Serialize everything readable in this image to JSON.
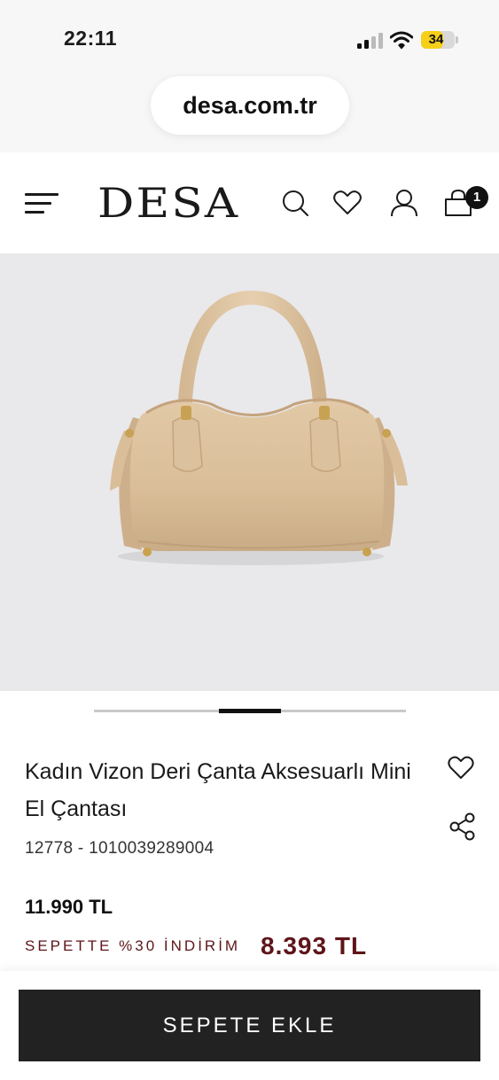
{
  "status_bar": {
    "time": "22:11",
    "battery_level": "34",
    "battery_percent": 34,
    "battery_color": "#f5cf18",
    "icons": [
      "signal-icon",
      "wifi-icon",
      "battery-icon"
    ]
  },
  "browser": {
    "url": "desa.com.tr"
  },
  "header": {
    "logo": "DESA",
    "cart_count": "1",
    "icons": [
      "menu-icon",
      "search-icon",
      "heart-icon",
      "user-icon",
      "shopping-bag-icon"
    ]
  },
  "gallery": {
    "image_alt": "beige-leather-mini-handbag",
    "current_slide": 2,
    "total_slides": 5
  },
  "product": {
    "title": "Kadın Vizon Deri Çanta Aksesuarlı Mini El Çantası",
    "code": "12778 - 1010039289004",
    "price": "11.990 TL",
    "discount_label": "SEPETTE %30 İNDİRİM",
    "discounted_price": "8.393 TL",
    "accent_color": "#5e1519"
  },
  "actions": {
    "add_to_cart": "SEPETE EKLE"
  }
}
